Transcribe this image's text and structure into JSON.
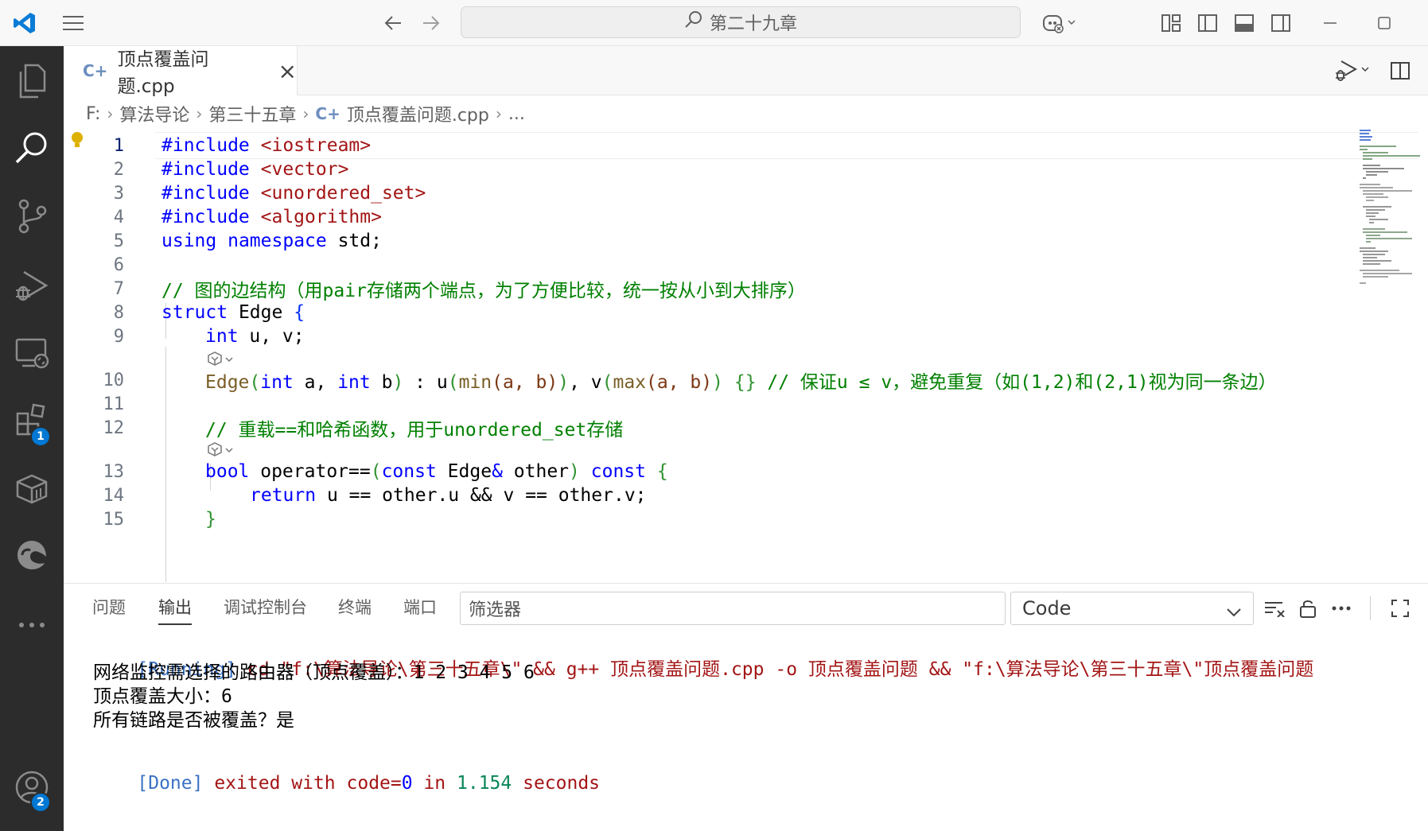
{
  "titlebar": {
    "search_text": "第二十九章",
    "icons": [
      "vscode-logo",
      "menu-icon",
      "back-arrow-icon",
      "forward-arrow-icon",
      "search-icon",
      "copilot-icon",
      "layout-icon",
      "toggle-sidebar-icon",
      "toggle-panel-icon",
      "toggle-secondary-sidebar-icon",
      "minimize-icon",
      "maximize-icon"
    ]
  },
  "activity": {
    "icons": [
      "explorer-icon",
      "search-icon",
      "source-control-icon",
      "run-debug-icon",
      "remote-explorer-icon",
      "extensions-icon",
      "package-icon",
      "edge-icon",
      "more-icon",
      "account-icon"
    ],
    "extensions_badge": "1",
    "account_badge": "2"
  },
  "tab": {
    "file_icon": "C+",
    "title": "顶点覆盖问题.cpp",
    "close": "×"
  },
  "breadcrumb": {
    "drive": "F:",
    "folder1": "算法导论",
    "folder2": "第三十五章",
    "file": "顶点覆盖问题.cpp",
    "more": "..."
  },
  "editor": {
    "line_numbers": [
      "1",
      "2",
      "3",
      "4",
      "5",
      "6",
      "7",
      "8",
      "9",
      "10",
      "11",
      "12",
      "13",
      "14",
      "15"
    ],
    "lines": {
      "l1_kw": "#include",
      "l1_hdr": "<iostream>",
      "l2_kw": "#include",
      "l2_hdr": "<vector>",
      "l3_kw": "#include",
      "l3_hdr": "<unordered_set>",
      "l4_kw": "#include",
      "l4_hdr": "<algorithm>",
      "l5_a": "using",
      "l5_b": "namespace",
      "l5_c": " std;",
      "l7": "// 图的边结构（用pair存储两个端点，为了方便比较，统一按从小到大排序）",
      "l8_kw": "struct",
      "l8_name": " Edge ",
      "l8_br": "{",
      "l9_kw": "int",
      "l9_rest": " u, v;",
      "l10_a": "Edge",
      "l10_b": "(",
      "l10_c": "int",
      "l10_d": " a, ",
      "l10_e": "int",
      "l10_f": " b",
      "l10_g": ")",
      "l10_h": " : ",
      "l10_i": "u",
      "l10_j": "(",
      "l10_k": "min",
      "l10_l": "(a, b)",
      "l10_m": ")",
      "l10_n": ", ",
      "l10_o": "v",
      "l10_p": "(",
      "l10_q": "max",
      "l10_r": "(a, b)",
      "l10_s": ")",
      "l10_t": " ",
      "l10_u": "{}",
      "l10_cmt": " // 保证u ≤ v，避免重复（如(1,2)和(2,1)视为同一条边）",
      "l12": "// 重载==和哈希函数，用于unordered_set存储",
      "l13_kw": "bool",
      "l13_b": " operator==",
      "l13_c": "(",
      "l13_d": "const",
      "l13_e": " Edge",
      "l13_f": "&",
      "l13_g": " other",
      "l13_h": ")",
      "l13_i": " ",
      "l13_j": "const",
      "l13_k": " ",
      "l13_l": "{",
      "l14_kw": "return",
      "l14_rest": " u == other.u && v == other.v;",
      "l15": "}"
    }
  },
  "panel": {
    "tabs": [
      "问题",
      "输出",
      "调试控制台",
      "终端",
      "端口"
    ],
    "filter_placeholder": "筛选器",
    "channel": "Code",
    "output": {
      "run_tag": "[Running]",
      "run_cmd": " cd \"f:\\算法导论\\第三十五章\\\" && g++ 顶点覆盖问题.cpp -o 顶点覆盖问题 && \"f:\\算法导论\\第三十五章\\\"顶点覆盖问题",
      "out1": "网络监控需选择的路由器（顶点覆盖）：1 2 3 4 5 6",
      "out2": "顶点覆盖大小：6",
      "out3": "所有链路是否被覆盖？是",
      "done_tag": "[Done]",
      "done_a": " exited ",
      "done_b": "with",
      "done_c": " code=",
      "done_d": "0",
      "done_e": " in ",
      "done_f": "1.154",
      "done_g": " seconds"
    }
  },
  "colors": {
    "accent": "#0078d4",
    "activity_bg": "#2c2c2c",
    "keyword": "#0000ff",
    "string": "#a31515",
    "comment": "#008000"
  }
}
